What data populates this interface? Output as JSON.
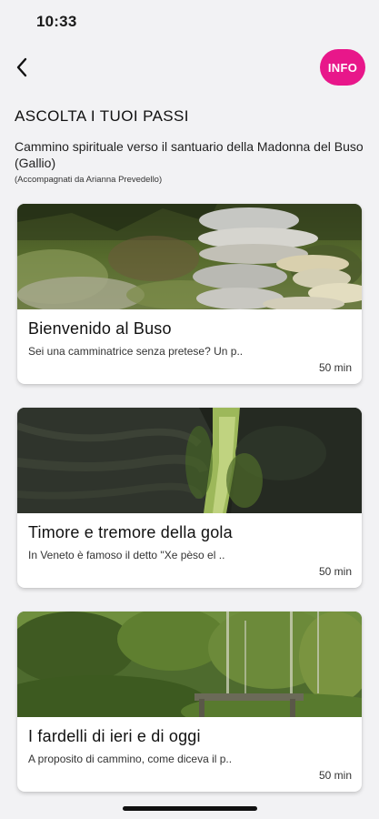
{
  "status_bar": {
    "time": "10:33"
  },
  "nav": {
    "back_icon": "chevron-left-icon",
    "info_label": "INFO",
    "accent": "#e8178a"
  },
  "header": {
    "title": "ASCOLTA I TUOI PASSI",
    "subtitle": "Cammino spirituale verso il santuario della Madonna del Buso (Gallio)",
    "note": "(Accompagnati da Arianna Prevedello)"
  },
  "tracks": [
    {
      "title": "Bienvenido al Buso",
      "description": "Sei una camminatrice senza pretese? Un p..",
      "duration": "50 min"
    },
    {
      "title": "Timore e tremore della gola",
      "description": "In Veneto è famoso il detto \"Xe pèso el ..",
      "duration": "50 min"
    },
    {
      "title": "I fardelli di ieri e di oggi",
      "description": "A proposito di cammino, come diceva il p..",
      "duration": "50 min"
    }
  ]
}
